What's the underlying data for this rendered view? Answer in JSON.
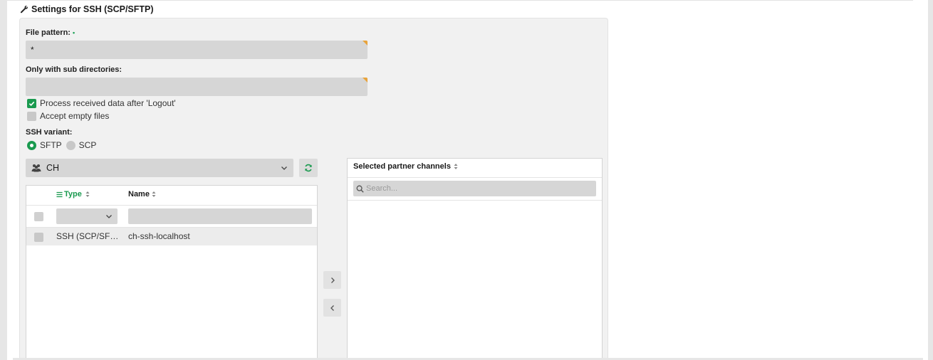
{
  "section": {
    "title": "Settings for SSH (SCP/SFTP)",
    "icon": "wrench-icon"
  },
  "file_pattern": {
    "label": "File pattern:",
    "required_marker": "•",
    "value": "*"
  },
  "sub_directories": {
    "label": "Only with sub directories:",
    "value": ""
  },
  "options": {
    "process_after_logout": {
      "label": "Process received data after 'Logout'",
      "checked": true
    },
    "accept_empty_files": {
      "label": "Accept empty files",
      "checked": false
    }
  },
  "ssh_variant": {
    "label": "SSH variant:",
    "options": [
      {
        "label": "SFTP",
        "selected": true
      },
      {
        "label": "SCP",
        "selected": false
      }
    ]
  },
  "partner_select": {
    "value": "CH",
    "icon": "people-icon"
  },
  "channel_table": {
    "columns": {
      "type": "Type",
      "name": "Name"
    },
    "rows": [
      {
        "type": "SSH (SCP/SFTP)",
        "name": "ch-ssh-localhost",
        "checked": false
      }
    ]
  },
  "selected_channels": {
    "header": "Selected partner channels",
    "search_placeholder": "Search..."
  },
  "colors": {
    "accent_green": "#1a9a4f",
    "marker_orange": "#e8a33b",
    "panel_bg": "#f1f1f1",
    "field_bg": "#d6d6d6"
  }
}
